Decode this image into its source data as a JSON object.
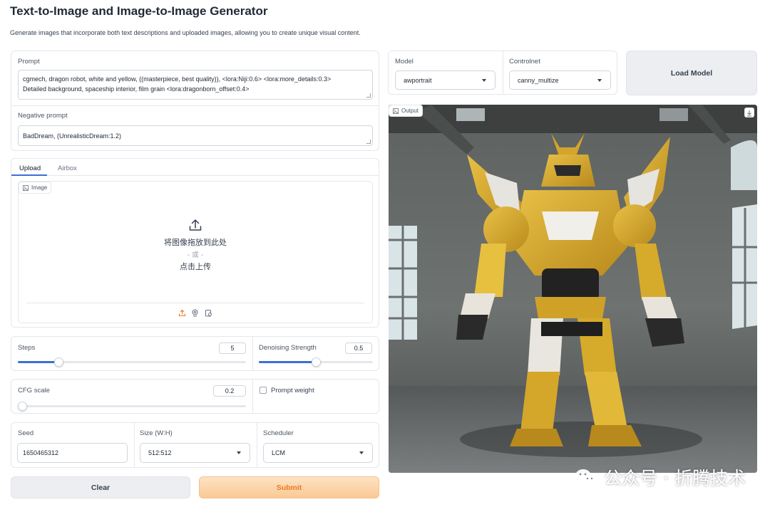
{
  "header": {
    "title": "Text-to-Image and Image-to-Image Generator",
    "subtitle": "Generate images that incorporate both text descriptions and uploaded images, allowing you to create unique visual content."
  },
  "prompt": {
    "label": "Prompt",
    "line1": "cgmech, dragon robot, white and yellow, ((masterpiece, best quality)),   <lora:Niji:0.6> <lora:more_details:0.3>",
    "line2": "Detailed background, spaceship interior, film grain <lora:dragonborn_offset:0.4>"
  },
  "negative_prompt": {
    "label": "Negative prompt",
    "value": "BadDream, (UnrealisticDream:1.2)"
  },
  "tabs": [
    {
      "label": "Upload",
      "active": true
    },
    {
      "label": "Airbox",
      "active": false
    }
  ],
  "upload": {
    "tag": "Image",
    "drop_text": "将图像拖放到此处",
    "or_text": "- 或 -",
    "click_text": "点击上传"
  },
  "steps": {
    "label": "Steps",
    "value": "5",
    "fraction": 0.18
  },
  "denoising": {
    "label": "Denoising Strength",
    "value": "0.5",
    "fraction": 0.5
  },
  "cfg": {
    "label": "CFG scale",
    "value": "0.2",
    "fraction": 0.02
  },
  "prompt_weight": {
    "label": "Prompt weight",
    "checked": false
  },
  "seed": {
    "label": "Seed",
    "value": "1650465312"
  },
  "size": {
    "label": "Size (W:H)",
    "value": "512:512"
  },
  "scheduler": {
    "label": "Scheduler",
    "value": "LCM"
  },
  "model": {
    "label": "Model",
    "value": "awportrait"
  },
  "controlnet": {
    "label": "Controlnet",
    "value": "canny_multize"
  },
  "buttons": {
    "load_model": "Load Model",
    "clear": "Clear",
    "submit": "Submit"
  },
  "output": {
    "tag": "Output"
  },
  "watermark": "公众号 · 折腾技术",
  "colors": {
    "accent": "#3b6fd6",
    "submit_bg": "#fbd3a6",
    "submit_text": "#ea7a23",
    "button_gray": "#eceef1",
    "robot_yellow": "#d8a928"
  }
}
